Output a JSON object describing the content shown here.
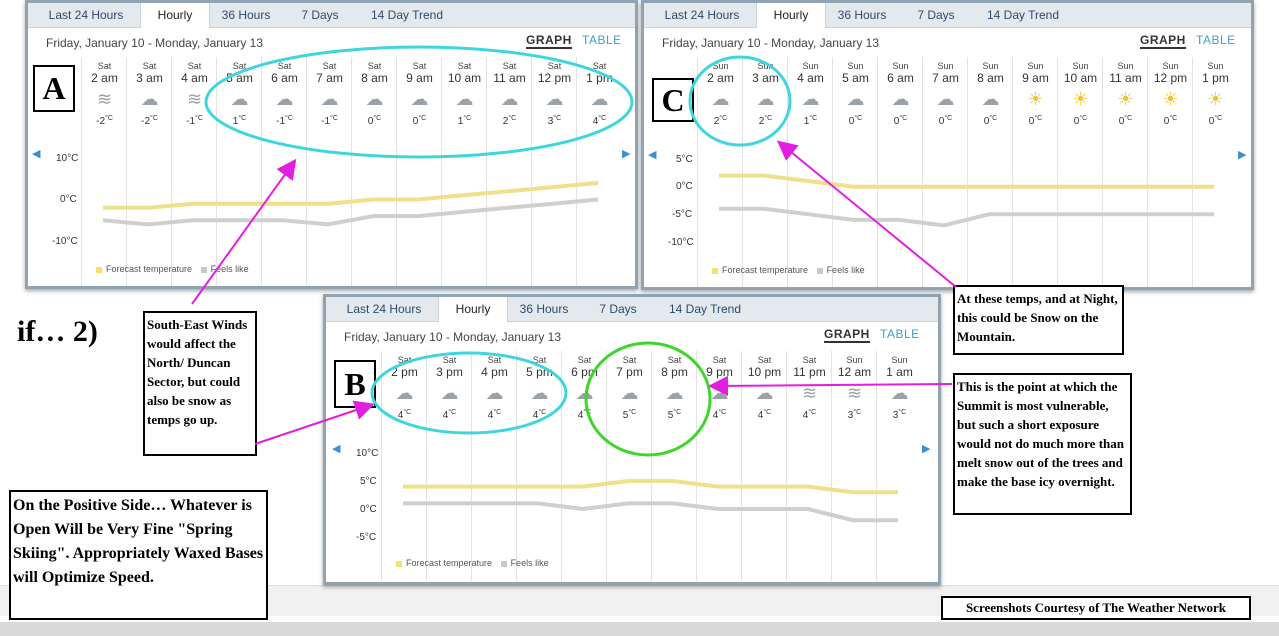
{
  "tabs": [
    "Last 24 Hours",
    "Hourly",
    "36 Hours",
    "7 Days",
    "14 Day Trend"
  ],
  "view_graph": "GRAPH",
  "view_table": "TABLE",
  "legend_forecast": "Forecast temperature",
  "legend_feels": "Feels like",
  "panel_a": {
    "date_range": "Friday, January 10 - Monday, January 13",
    "y_labels": [
      "10°C",
      "0°C",
      "-10°C"
    ],
    "hours": [
      {
        "day": "Sat",
        "time": "2 am",
        "temp": "-2",
        "icon": "fog-icon"
      },
      {
        "day": "Sat",
        "time": "3 am",
        "temp": "-2",
        "icon": "snow-icon"
      },
      {
        "day": "Sat",
        "time": "4 am",
        "temp": "-1",
        "icon": "fog-icon"
      },
      {
        "day": "Sat",
        "time": "5 am",
        "temp": "1",
        "icon": "snow-icon"
      },
      {
        "day": "Sat",
        "time": "6 am",
        "temp": "-1",
        "icon": "snow-icon"
      },
      {
        "day": "Sat",
        "time": "7 am",
        "temp": "-1",
        "icon": "snow-icon"
      },
      {
        "day": "Sat",
        "time": "8 am",
        "temp": "0",
        "icon": "snow-icon"
      },
      {
        "day": "Sat",
        "time": "9 am",
        "temp": "0",
        "icon": "rain-icon"
      },
      {
        "day": "Sat",
        "time": "10 am",
        "temp": "1",
        "icon": "rain-icon"
      },
      {
        "day": "Sat",
        "time": "11 am",
        "temp": "2",
        "icon": "snow-icon"
      },
      {
        "day": "Sat",
        "time": "12 pm",
        "temp": "3",
        "icon": "snow-icon"
      },
      {
        "day": "Sat",
        "time": "1 pm",
        "temp": "4",
        "icon": "rain-icon"
      }
    ]
  },
  "panel_b": {
    "date_range": "Friday, January 10 - Monday, January 13",
    "y_labels": [
      "10°C",
      "5°C",
      "0°C",
      "-5°C"
    ],
    "hours": [
      {
        "day": "Sat",
        "time": "2 pm",
        "temp": "4",
        "icon": "rain-icon"
      },
      {
        "day": "Sat",
        "time": "3 pm",
        "temp": "4",
        "icon": "rain-icon"
      },
      {
        "day": "Sat",
        "time": "4 pm",
        "temp": "4",
        "icon": "rain-icon"
      },
      {
        "day": "Sat",
        "time": "5 pm",
        "temp": "4",
        "icon": "rain-icon"
      },
      {
        "day": "Sat",
        "time": "6 pm",
        "temp": "4",
        "icon": "rain-icon"
      },
      {
        "day": "Sat",
        "time": "7 pm",
        "temp": "5",
        "icon": "cloud-icon"
      },
      {
        "day": "Sat",
        "time": "8 pm",
        "temp": "5",
        "icon": "cloud-icon"
      },
      {
        "day": "Sat",
        "time": "9 pm",
        "temp": "4",
        "icon": "rain-icon"
      },
      {
        "day": "Sat",
        "time": "10 pm",
        "temp": "4",
        "icon": "rain-icon"
      },
      {
        "day": "Sat",
        "time": "11 pm",
        "temp": "4",
        "icon": "fog-icon"
      },
      {
        "day": "Sun",
        "time": "12 am",
        "temp": "3",
        "icon": "fog-icon"
      },
      {
        "day": "Sun",
        "time": "1 am",
        "temp": "3",
        "icon": "rain-icon"
      }
    ]
  },
  "panel_c": {
    "date_range": "Friday, January 10 - Monday, January 13",
    "y_labels": [
      "5°C",
      "0°C",
      "-5°C",
      "-10°C"
    ],
    "hours": [
      {
        "day": "Sun",
        "time": "2 am",
        "temp": "2",
        "icon": "snow-icon"
      },
      {
        "day": "Sun",
        "time": "3 am",
        "temp": "2",
        "icon": "snow-icon"
      },
      {
        "day": "Sun",
        "time": "4 am",
        "temp": "1",
        "icon": "cloud-icon"
      },
      {
        "day": "Sun",
        "time": "5 am",
        "temp": "0",
        "icon": "cloud-icon"
      },
      {
        "day": "Sun",
        "time": "6 am",
        "temp": "0",
        "icon": "cloud-icon"
      },
      {
        "day": "Sun",
        "time": "7 am",
        "temp": "0",
        "icon": "cloud-icon"
      },
      {
        "day": "Sun",
        "time": "8 am",
        "temp": "0",
        "icon": "cloud-icon"
      },
      {
        "day": "Sun",
        "time": "9 am",
        "temp": "0",
        "icon": "sun-cloud-icon"
      },
      {
        "day": "Sun",
        "time": "10 am",
        "temp": "0",
        "icon": "sun-cloud-icon"
      },
      {
        "day": "Sun",
        "time": "11 am",
        "temp": "0",
        "icon": "sun-cloud-icon"
      },
      {
        "day": "Sun",
        "time": "12 pm",
        "temp": "0",
        "icon": "sun-cloud-icon"
      },
      {
        "day": "Sun",
        "time": "1 pm",
        "temp": "0",
        "icon": "sun-cloud-icon"
      }
    ]
  },
  "labels": {
    "a": "A",
    "b": "B",
    "c": "C",
    "if_mark": "if… 2)"
  },
  "notes": {
    "south_east": "South-East Winds would affect the North/ Duncan Sector, but could also be snow as temps go up.",
    "these_temps": "At these temps, and at Night, this could be Snow on the Mountain.",
    "summit": "This is the point at which the Summit is most vulnerable, but such a short exposure would not do much more than melt snow out of the trees and make the base icy overnight.",
    "positive": "On the Positive Side… Whatever is Open Will be Very Fine \"Spring Skiing\". Appropriately Waxed Bases will Optimize Speed.",
    "credit": "Screenshots Courtesy of The Weather Network"
  },
  "unit": "°C",
  "chart_data": [
    {
      "type": "line",
      "categories": [
        "2 am",
        "3 am",
        "4 am",
        "5 am",
        "6 am",
        "7 am",
        "8 am",
        "9 am",
        "10 am",
        "11 am",
        "12 pm",
        "1 pm"
      ],
      "series": [
        {
          "name": "Forecast temperature",
          "values": [
            -2,
            -2,
            -1,
            -1,
            -1,
            -1,
            0,
            0,
            1,
            2,
            3,
            4
          ]
        },
        {
          "name": "Feels like",
          "values": [
            -5,
            -6,
            -5,
            -5,
            -5,
            -6,
            -4,
            -4,
            -3,
            -2,
            -1,
            0
          ]
        }
      ],
      "ylim": [
        -10,
        10
      ]
    },
    {
      "type": "line",
      "categories": [
        "2 pm",
        "3 pm",
        "4 pm",
        "5 pm",
        "6 pm",
        "7 pm",
        "8 pm",
        "9 pm",
        "10 pm",
        "11 pm",
        "12 am",
        "1 am"
      ],
      "series": [
        {
          "name": "Forecast temperature",
          "values": [
            4,
            4,
            4,
            4,
            4,
            5,
            5,
            4,
            4,
            4,
            3,
            3
          ]
        },
        {
          "name": "Feels like",
          "values": [
            1,
            1,
            1,
            1,
            0,
            1,
            1,
            0,
            0,
            0,
            -2,
            -2
          ]
        }
      ],
      "ylim": [
        -5,
        10
      ]
    },
    {
      "type": "line",
      "categories": [
        "2 am",
        "3 am",
        "4 am",
        "5 am",
        "6 am",
        "7 am",
        "8 am",
        "9 am",
        "10 am",
        "11 am",
        "12 pm",
        "1 pm"
      ],
      "series": [
        {
          "name": "Forecast temperature",
          "values": [
            2,
            2,
            1,
            0,
            0,
            0,
            0,
            0,
            0,
            0,
            0,
            0
          ]
        },
        {
          "name": "Feels like",
          "values": [
            -4,
            -4,
            -5,
            -6,
            -6,
            -7,
            -5,
            -5,
            -5,
            -5,
            -5,
            -5
          ]
        }
      ],
      "ylim": [
        -10,
        5
      ]
    }
  ]
}
